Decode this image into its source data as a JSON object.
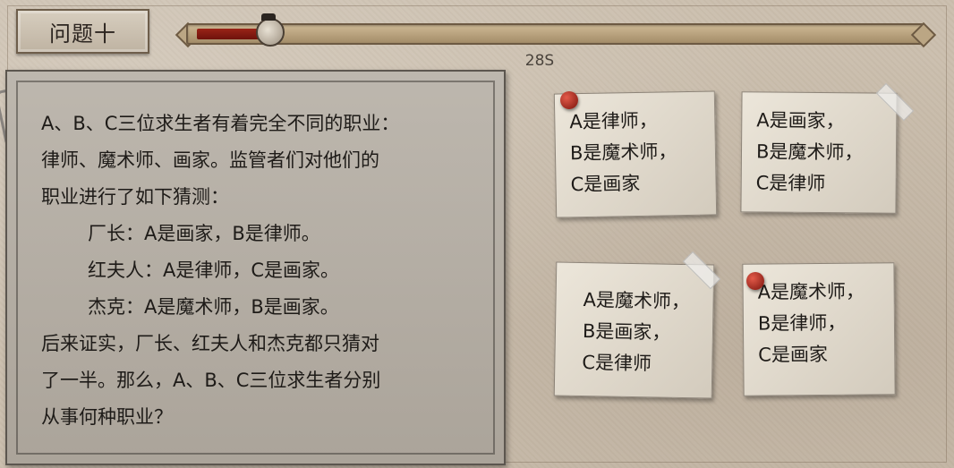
{
  "header": {
    "title": "问题十"
  },
  "timer": {
    "text": "28S",
    "progress": 0.09
  },
  "question": {
    "lines": [
      "A、B、C三位求生者有着完全不同的职业：",
      "律师、魔术师、画家。监管者们对他们的",
      "职业进行了如下猜测：",
      "厂长：A是画家，B是律师。",
      "红夫人：A是律师，C是画家。",
      "杰克：A是魔术师，B是画家。",
      "后来证实，厂长、红夫人和杰克都只猜对",
      "了一半。那么，A、B、C三位求生者分别",
      "从事何种职业？"
    ]
  },
  "answers": [
    {
      "lines": [
        "A是律师，",
        "B是魔术师，",
        "C是画家"
      ]
    },
    {
      "lines": [
        "A是画家，",
        "B是魔术师，",
        "C是律师"
      ]
    },
    {
      "lines": [
        "A是魔术师，",
        "B是画家，",
        "C是律师"
      ]
    },
    {
      "lines": [
        "A是魔术师，",
        "B是律师，",
        "C是画家"
      ]
    }
  ],
  "colors": {
    "timer_fill": "#9a2418",
    "panel": "#b3ada4",
    "card": "#e2dbcd",
    "pin": "#a32a1c"
  }
}
